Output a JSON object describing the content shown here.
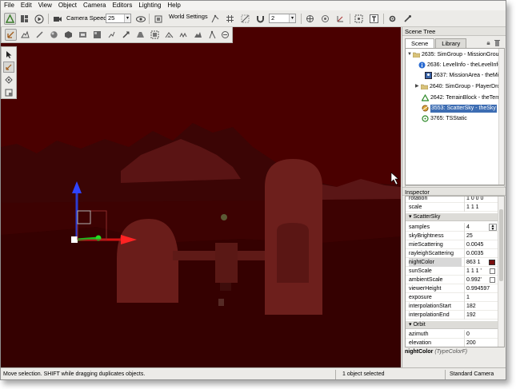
{
  "menu": [
    "File",
    "Edit",
    "View",
    "Object",
    "Camera",
    "Editors",
    "Lighting",
    "Help"
  ],
  "toolbar": {
    "camera_speed_label": "Camera Speed",
    "camera_speed_value": "25",
    "world_settings_label": "World Settings",
    "grid_value": "2"
  },
  "scene_tree": {
    "title": "Scene Tree",
    "tabs": [
      "Scene",
      "Library"
    ],
    "items": [
      {
        "text": "2635: SimGroup - MissionGroup",
        "icon": "folder-icon"
      },
      {
        "text": "2636: LevelInfo - theLevelInfo",
        "icon": "info-icon"
      },
      {
        "text": "2637: MissionArea - theMis",
        "icon": "mission-area-icon"
      },
      {
        "text": "2640: SimGroup - PlayerDropPo",
        "icon": "folder-icon"
      },
      {
        "text": "2642: TerrainBlock - theTerrain",
        "icon": "terrain-icon"
      },
      {
        "text": "3553: ScatterSky - theSky",
        "icon": "sky-icon",
        "selected": true
      },
      {
        "text": "3765: TSStatic",
        "icon": "static-mesh-icon"
      }
    ]
  },
  "inspector": {
    "title": "Inspector",
    "top_rows": [
      {
        "name": "rotation",
        "value": "1 0 0 0"
      },
      {
        "name": "scale",
        "value": "1 1 1"
      }
    ],
    "group_scattersky": "ScatterSky",
    "scattersky_rows": [
      {
        "name": "samples",
        "value": "4"
      },
      {
        "name": "skyBrightness",
        "value": "25"
      },
      {
        "name": "mieScattering",
        "value": "0.0045"
      },
      {
        "name": "rayleighScattering",
        "value": "0.0035"
      },
      {
        "name": "nightColor",
        "value": "863 1"
      },
      {
        "name": "sunScale",
        "value": "1 1 1 '"
      },
      {
        "name": "ambientScale",
        "value": "0.992'"
      },
      {
        "name": "viewerHeight",
        "value": "0.994597"
      },
      {
        "name": "exposure",
        "value": "1"
      },
      {
        "name": "interpolationStart",
        "value": "182"
      },
      {
        "name": "interpolationEnd",
        "value": "192"
      }
    ],
    "group_orbit": "Orbit",
    "orbit_rows": [
      {
        "name": "azimuth",
        "value": "0"
      },
      {
        "name": "elevation",
        "value": "200"
      }
    ],
    "field_name": "nightColor",
    "field_type": "(TypeColorF)"
  },
  "status": {
    "hint": "Move selection.  SHIFT while dragging duplicates objects.",
    "selection": "1 object selected",
    "camera": "Standard Camera"
  },
  "colors": {
    "viewport_tint": "#4a0000",
    "selection": "#3d6db3",
    "night_color_swatch": "#7a0f0f"
  }
}
